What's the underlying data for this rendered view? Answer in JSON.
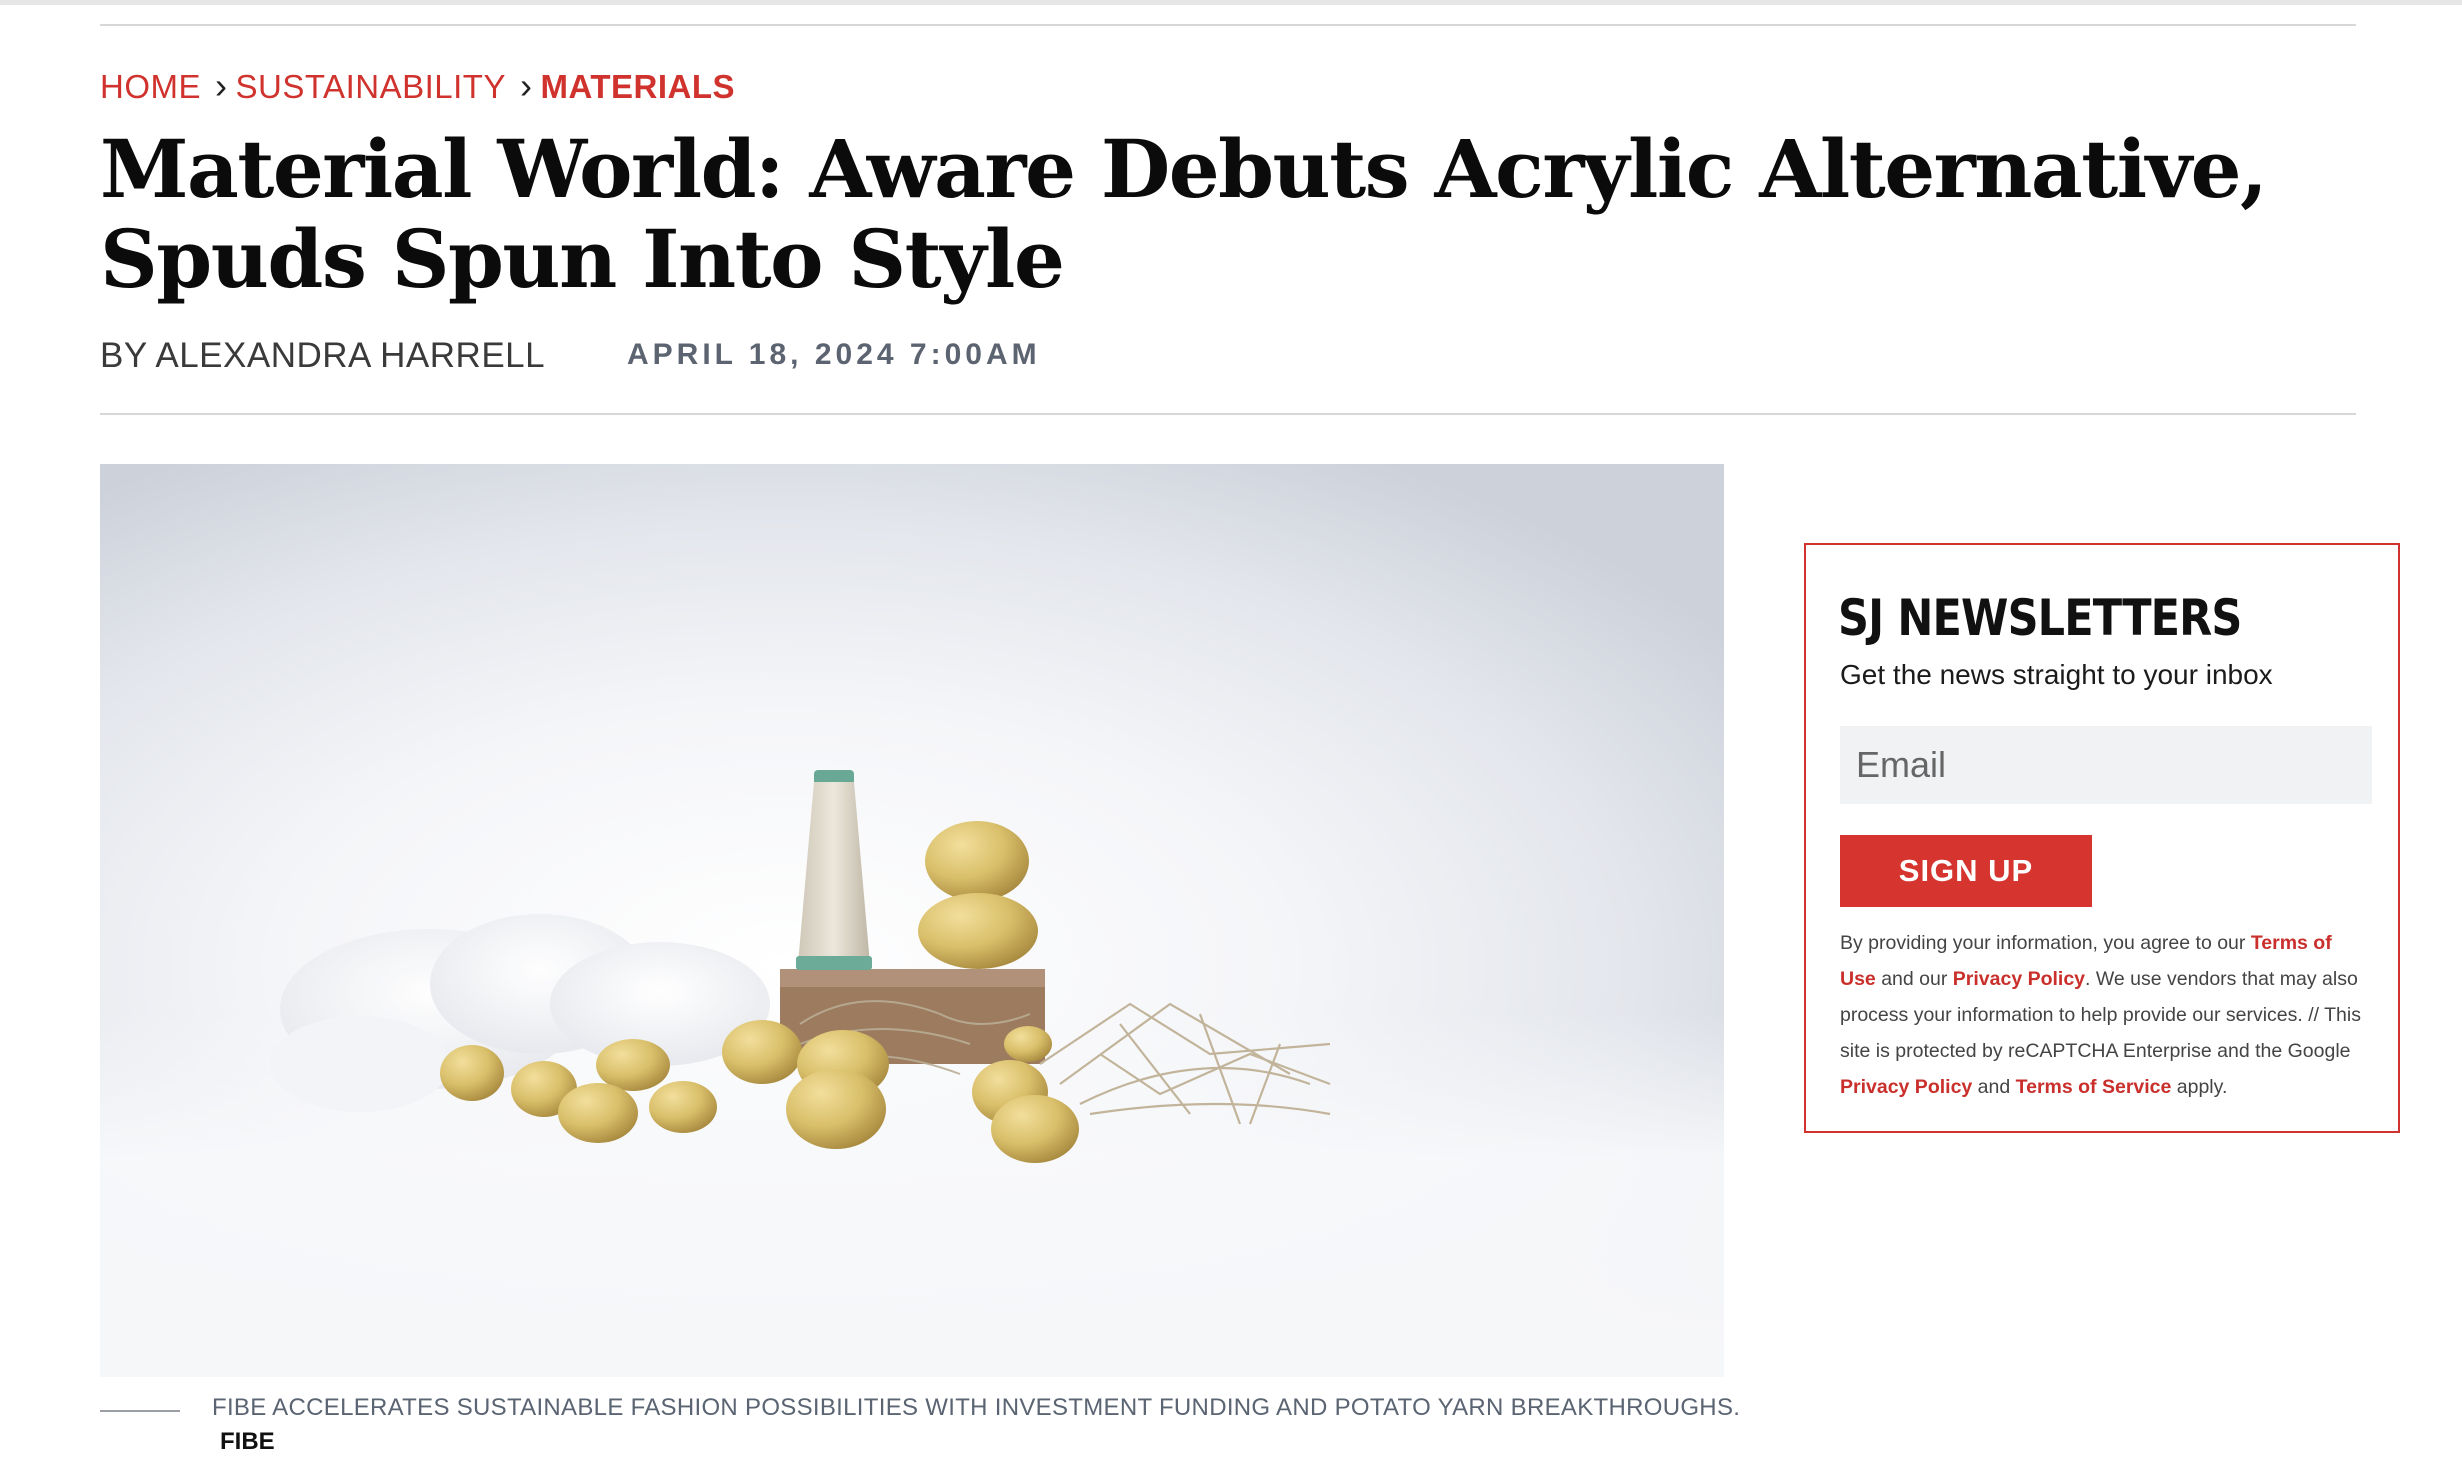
{
  "breadcrumb": {
    "items": [
      {
        "label": "HOME"
      },
      {
        "label": "SUSTAINABILITY"
      },
      {
        "label": "MATERIALS"
      }
    ],
    "separator": "›"
  },
  "article": {
    "headline": "Material World: Aware Debuts Acrylic Alternative, Spuds Spun Into Style",
    "byline": "BY ALEXANDRA HARRELL",
    "date": "APRIL 18, 2024 7:00AM",
    "hero_image": {
      "caption": "FIBE ACCELERATES SUSTAINABLE FASHION POSSIBILITIES WITH INVESTMENT FUNDING AND POTATO YARN BREAKTHROUGHS.",
      "credit": "FIBE"
    }
  },
  "newsletter": {
    "title": "SJ NEWSLETTERS",
    "subtitle": "Get the news straight to your inbox",
    "email_placeholder": "Email",
    "button_label": "SIGN UP",
    "legal": {
      "t1": "By providing your information, you agree to our ",
      "terms_of_use": "Terms of Use",
      "t2": " and our ",
      "privacy_policy": "Privacy Policy",
      "t3": ". We use vendors that may also process your information to help provide our services. // This site is protected by reCAPTCHA Enterprise and the Google ",
      "privacy_policy_2": "Privacy Policy",
      "t4": " and ",
      "terms_of_service": "Terms of Service",
      "t5": " apply."
    }
  },
  "colors": {
    "accent": "#d0322d",
    "headline": "#0b0b0b",
    "date": "#5b6470"
  }
}
